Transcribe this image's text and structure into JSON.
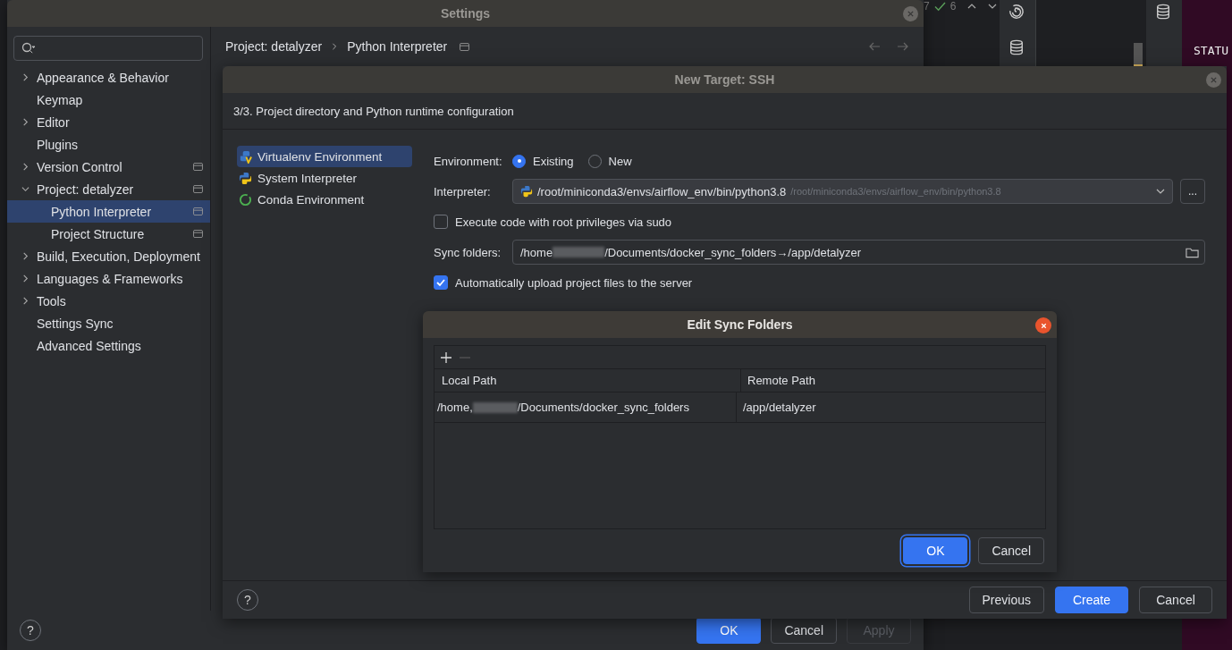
{
  "background_ide": {
    "counts": [
      {
        "text": "7",
        "kind": "plain"
      },
      {
        "text": "6",
        "kind": "check"
      }
    ],
    "terminal_text": "STATU"
  },
  "settings": {
    "title": "Settings",
    "breadcrumb": [
      "Project: detalyzer",
      "Python Interpreter"
    ],
    "sidebar": [
      {
        "label": "Appearance & Behavior",
        "expanded": false,
        "selected": false,
        "project_scope": false
      },
      {
        "label": "Keymap",
        "selected": false,
        "project_scope": false
      },
      {
        "label": "Editor",
        "expanded": false,
        "selected": false,
        "project_scope": false
      },
      {
        "label": "Plugins",
        "selected": false,
        "project_scope": false
      },
      {
        "label": "Version Control",
        "expanded": false,
        "selected": false,
        "project_scope": true
      },
      {
        "label": "Project: detalyzer",
        "expanded": true,
        "selected": false,
        "project_scope": true,
        "children": [
          {
            "label": "Python Interpreter",
            "selected": true,
            "project_scope": true
          },
          {
            "label": "Project Structure",
            "selected": false,
            "project_scope": true
          }
        ]
      },
      {
        "label": "Build, Execution, Deployment",
        "expanded": false,
        "selected": false,
        "project_scope": false
      },
      {
        "label": "Languages & Frameworks",
        "expanded": false,
        "selected": false,
        "project_scope": false
      },
      {
        "label": "Tools",
        "expanded": false,
        "selected": false,
        "project_scope": false
      },
      {
        "label": "Settings Sync",
        "selected": false,
        "project_scope": false
      },
      {
        "label": "Advanced Settings",
        "selected": false,
        "project_scope": false
      }
    ],
    "help": "?",
    "buttons": [
      {
        "label": "OK",
        "primary": true,
        "disabled": false
      },
      {
        "label": "Cancel",
        "primary": false,
        "disabled": false
      },
      {
        "label": "Apply",
        "primary": false,
        "disabled": true
      }
    ]
  },
  "new_target": {
    "title": "New Target: SSH",
    "step": "3/3. Project directory and Python runtime configuration",
    "env_types": [
      {
        "label": "Virtualenv Environment",
        "kind": "virtualenv",
        "selected": true
      },
      {
        "label": "System Interpreter",
        "kind": "system",
        "selected": false
      },
      {
        "label": "Conda Environment",
        "kind": "conda",
        "selected": false
      }
    ],
    "environment": {
      "label": "Environment:",
      "options": [
        {
          "label": "Existing",
          "selected": true
        },
        {
          "label": "New",
          "selected": false
        }
      ]
    },
    "interpreter": {
      "label": "Interpreter:",
      "value": "/root/miniconda3/envs/airflow_env/bin/python3.8",
      "hint": "/root/miniconda3/envs/airflow_env/bin/python3.8",
      "browse": "..."
    },
    "sudo": {
      "label": "Execute code with root privileges via sudo",
      "checked": false
    },
    "sync_folders": {
      "label": "Sync folders:",
      "value_start": "/home",
      "value_end": "/Documents/docker_sync_folders→/app/detalyzer"
    },
    "auto_upload": {
      "label": "Automatically upload project files to the server",
      "checked": true
    },
    "help": "?",
    "buttons": [
      {
        "label": "Previous",
        "primary": false
      },
      {
        "label": "Create",
        "primary": true
      },
      {
        "label": "Cancel",
        "primary": false
      }
    ]
  },
  "edit_sync": {
    "title": "Edit Sync Folders",
    "columns": [
      "Local Path",
      "Remote Path"
    ],
    "rows": [
      {
        "local_start": "/home,",
        "local_end": "/Documents/docker_sync_folders",
        "remote": "/app/detalyzer"
      }
    ],
    "buttons": [
      {
        "label": "OK",
        "primary": true
      },
      {
        "label": "Cancel",
        "primary": false
      }
    ]
  }
}
